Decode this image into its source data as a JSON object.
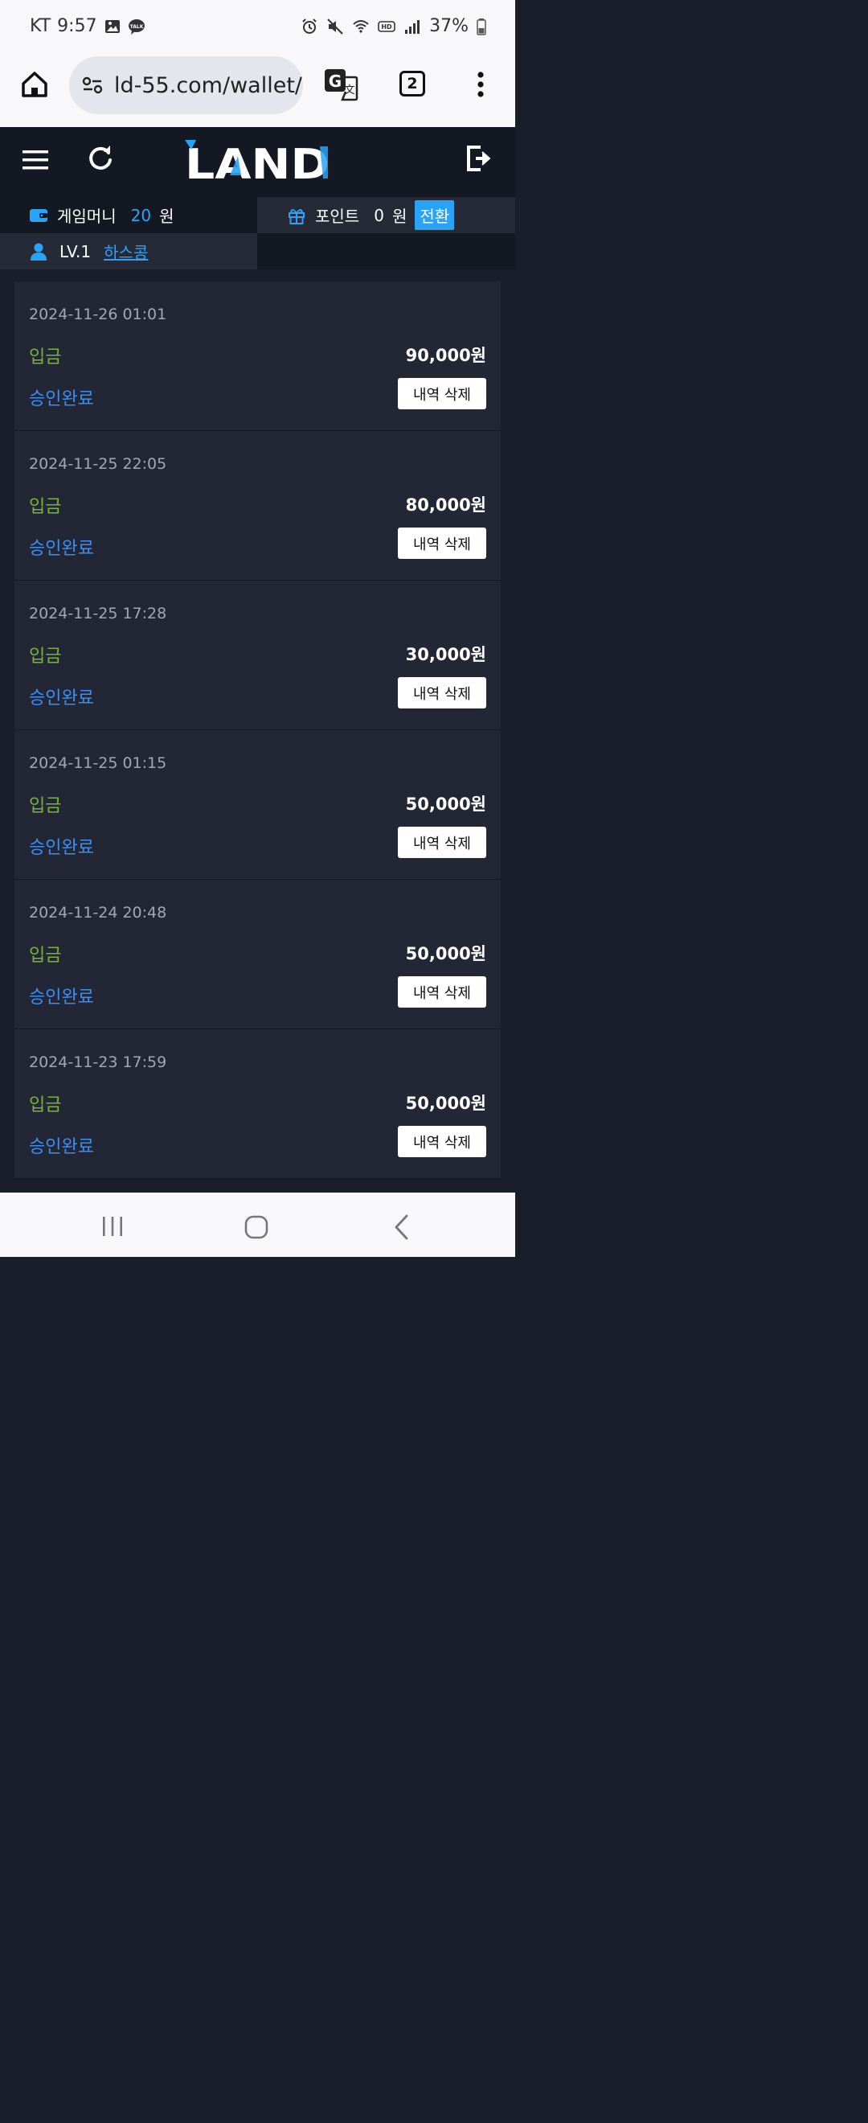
{
  "status_bar": {
    "carrier": "KT",
    "time": "9:57",
    "battery": "37%"
  },
  "browser": {
    "url": "ld-55.com/wallet/",
    "tab_count": "2"
  },
  "app": {
    "logo_text": "LAND"
  },
  "info": {
    "game_money_label": "게임머니",
    "game_money_value": "20",
    "game_money_unit": "원",
    "point_label": "포인트",
    "point_value": "0",
    "point_unit": "원",
    "convert_label": "전환",
    "level": "LV.1",
    "username": "하스콩"
  },
  "transactions": [
    {
      "date": "2024-11-26 01:01",
      "type": "입금",
      "amount": "90,000원",
      "status": "승인완료",
      "delete_label": "내역 삭제"
    },
    {
      "date": "2024-11-25 22:05",
      "type": "입금",
      "amount": "80,000원",
      "status": "승인완료",
      "delete_label": "내역 삭제"
    },
    {
      "date": "2024-11-25 17:28",
      "type": "입금",
      "amount": "30,000원",
      "status": "승인완료",
      "delete_label": "내역 삭제"
    },
    {
      "date": "2024-11-25 01:15",
      "type": "입금",
      "amount": "50,000원",
      "status": "승인완료",
      "delete_label": "내역 삭제"
    },
    {
      "date": "2024-11-24 20:48",
      "type": "입금",
      "amount": "50,000원",
      "status": "승인완료",
      "delete_label": "내역 삭제"
    },
    {
      "date": "2024-11-23 17:59",
      "type": "입금",
      "amount": "50,000원",
      "status": "승인완료",
      "delete_label": "내역 삭제"
    }
  ],
  "colors": {
    "background": "#1a1e2a",
    "card": "#232735",
    "deposit_green": "#7ab33b",
    "status_blue": "#3a8ff0",
    "accent_blue": "#29a3f5"
  }
}
